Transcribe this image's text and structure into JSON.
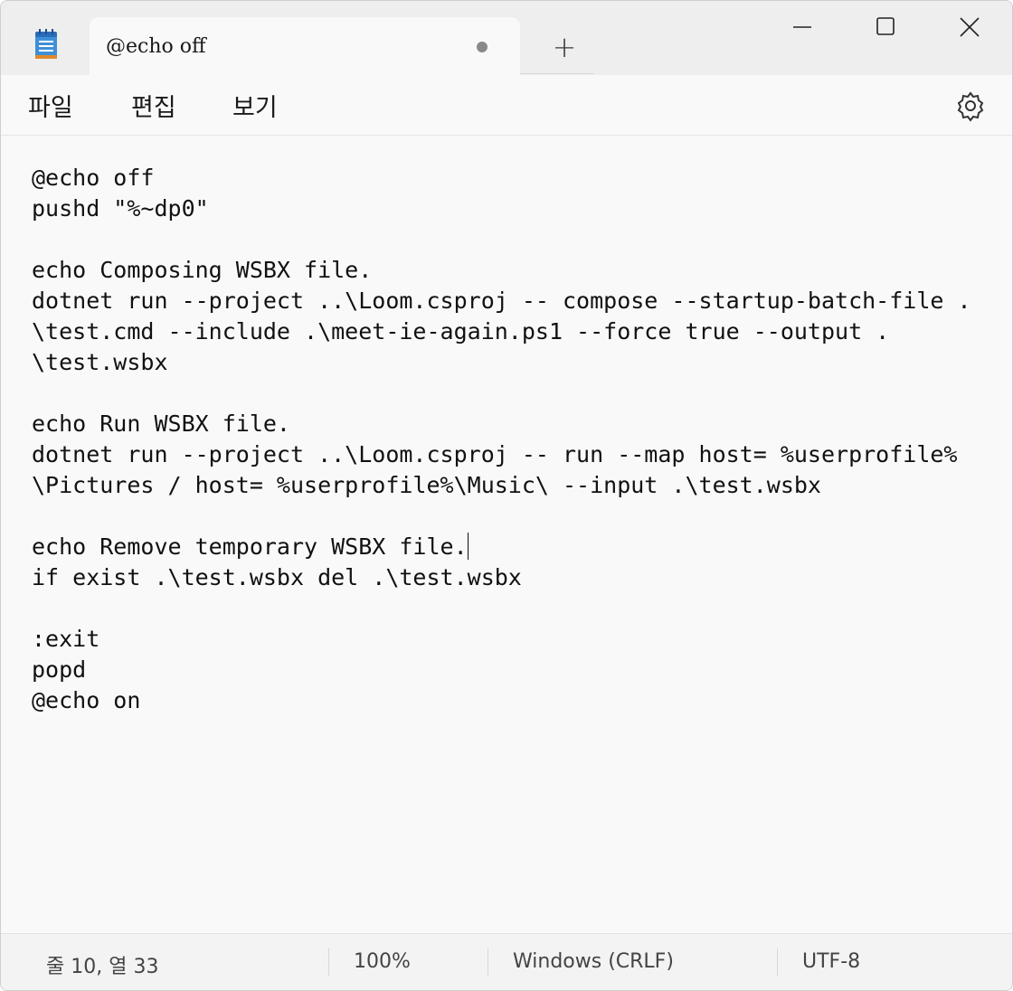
{
  "window": {
    "tab_title": "@echo off",
    "new_tab_label": "+",
    "accent_color": "#3b7dd8"
  },
  "menu": {
    "file": "파일",
    "edit": "편집",
    "view": "보기"
  },
  "editor": {
    "lines": [
      "@echo off",
      "pushd \"%~dp0\"",
      "",
      "echo Composing WSBX file.",
      "dotnet run --project ..\\Loom.csproj -- compose --startup-batch-file .",
      "\\test.cmd --include .\\meet-ie-again.ps1 --force true --output .",
      "\\test.wsbx",
      "",
      "echo Run WSBX file.",
      "dotnet run --project ..\\Loom.csproj -- run --map host= %userprofile%",
      "\\Pictures / host= %userprofile%\\Music\\ --input .\\test.wsbx",
      "",
      "echo Remove temporary WSBX file.",
      "if exist .\\test.wsbx del .\\test.wsbx",
      "",
      ":exit",
      "popd",
      "@echo on"
    ]
  },
  "status": {
    "position": "줄 10, 열 33",
    "zoom": "100%",
    "line_ending": "Windows (CRLF)",
    "encoding": "UTF-8"
  },
  "icons": {
    "app": "notepad-icon",
    "unsaved": "unsaved-dot-icon",
    "minimize": "minimize-icon",
    "maximize": "maximize-icon",
    "close": "close-icon",
    "settings": "gear-icon"
  }
}
